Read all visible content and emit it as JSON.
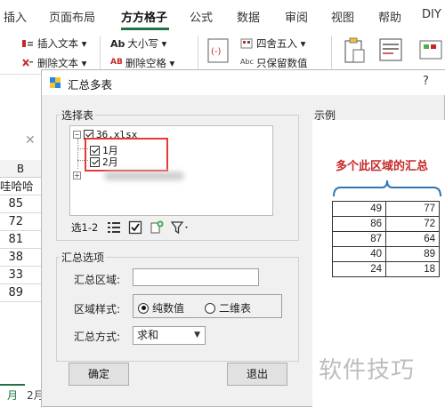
{
  "ribbon": {
    "tabs": [
      "插入",
      "页面布局",
      "方方格子",
      "公式",
      "数据",
      "审阅",
      "视图",
      "帮助",
      "DIY"
    ],
    "active_tab": "方方格子",
    "buttons": {
      "insert_text": "插入文本 ▾",
      "delete_text": "删除文本 ▾",
      "case": "大小写 ▾",
      "delete_space": "删除空格 ▾",
      "round": "四舍五入 ▾",
      "keep_values": "只保留数值",
      "ab_prefix": "Ab",
      "ab_prefix2": "AB",
      "abc_prefix": "Abc"
    },
    "accent": "#217346"
  },
  "sheet": {
    "formula_cancel": "✕",
    "column_header": "B",
    "cells": [
      "哇哈哈",
      "85",
      "72",
      "81",
      "38",
      "33",
      "89"
    ],
    "tab1": "月",
    "tab2": "2月"
  },
  "dialog": {
    "title": "汇总多表",
    "help": "?",
    "select_group": "选择表",
    "tree": {
      "file": "36.xlsx",
      "sheets": [
        "1月",
        "2月"
      ]
    },
    "selection_count": "选1-2",
    "options_group": "汇总选项",
    "region_label": "汇总区域:",
    "region_value": "",
    "style_label": "区域样式:",
    "style_options": [
      "纯数值",
      "二维表"
    ],
    "style_selected": "纯数值",
    "method_label": "汇总方式:",
    "method_value": "求和",
    "ok": "确定",
    "exit": "退出",
    "highlight_color": "#e53935"
  },
  "example": {
    "label": "示例",
    "title": "多个此区域的汇总",
    "title_color": "#c62828",
    "brace_color": "#2e75b6",
    "rows": [
      [
        "49",
        "77"
      ],
      [
        "86",
        "72"
      ],
      [
        "87",
        "64"
      ],
      [
        "40",
        "89"
      ],
      [
        "24",
        "18"
      ]
    ]
  },
  "watermark": "软件技巧"
}
